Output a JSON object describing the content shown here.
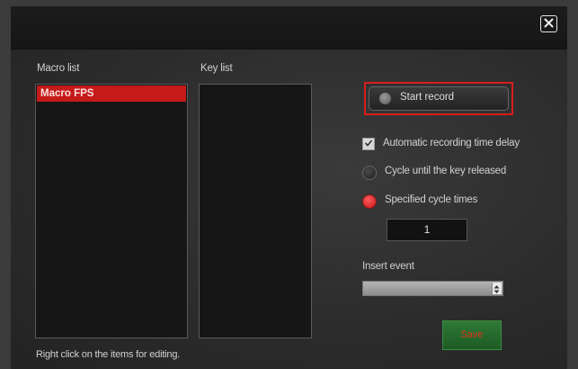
{
  "dialog": {
    "close_icon": "close-icon",
    "macro_list_label": "Macro list",
    "key_list_label": "Key list",
    "macro_items": [
      "Macro FPS"
    ],
    "start_record_label": "Start record",
    "options": {
      "auto_delay_label": "Automatic recording time delay",
      "auto_delay_checked": true,
      "cycle_until_release_label": "Cycle until the key released",
      "specified_cycle_label": "Specified cycle times",
      "selected_mode": "specified_cycle"
    },
    "cycle_times_value": "1",
    "insert_event_label": "Insert event",
    "insert_event_value": "",
    "save_label": "Save",
    "hint": "Right click on the items for editing."
  },
  "colors": {
    "accent_red": "#d91c1c",
    "save_green": "#2a6e31",
    "selected_item": "#c51a1a"
  }
}
